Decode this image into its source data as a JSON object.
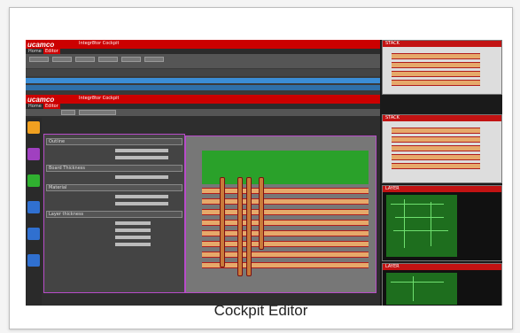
{
  "caption": "Cockpit Editor",
  "app": {
    "brand": "ucamco",
    "title": "Integr8tor Cockpit",
    "home_tab": "Home",
    "active_tab": "Editor"
  },
  "panels": {
    "stack_label": "STACK",
    "layer_label": "LAYER"
  },
  "form": {
    "sections": [
      "Outline",
      "Board Thickness",
      "Material",
      "Layer thickness"
    ]
  },
  "colors": {
    "title_red": "#c00000",
    "accent_purple": "#b84cc9",
    "board_green": "#2aa12a"
  },
  "icons": [
    "logo",
    "sidebar-stack-icon",
    "sidebar-layer-icon",
    "sidebar-add-icon",
    "sidebar-sym-icon"
  ]
}
